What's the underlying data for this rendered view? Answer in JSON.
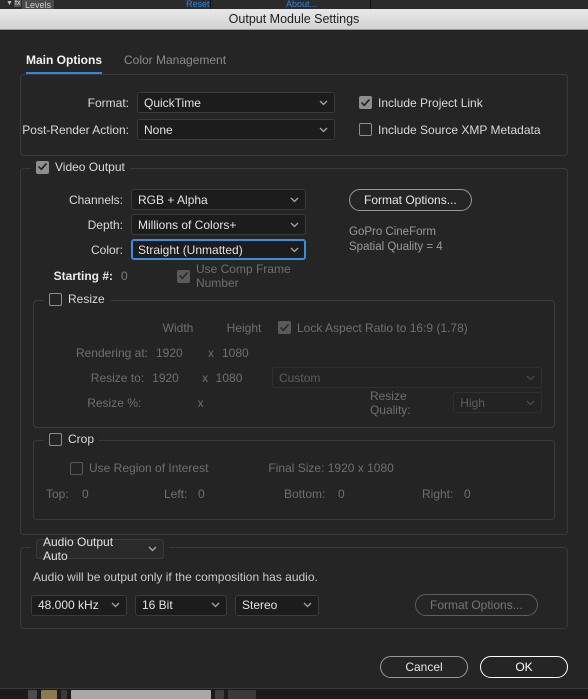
{
  "background_strip": {
    "caret": "▼",
    "fx_badge": "fx",
    "effect_name": "Levels",
    "reset_link": "Reset",
    "about_link": "About..."
  },
  "dialog": {
    "title": "Output Module Settings",
    "tabs": [
      {
        "label": "Main Options",
        "active": true
      },
      {
        "label": "Color Management",
        "active": false
      }
    ],
    "format_group": {
      "format_label": "Format:",
      "format_value": "QuickTime",
      "post_render_label": "Post-Render Action:",
      "post_render_value": "None",
      "include_project_link": {
        "label": "Include Project Link",
        "checked": true
      },
      "include_xmp": {
        "label": "Include Source XMP Metadata",
        "checked": false
      }
    },
    "video_output": {
      "legend": "Video Output",
      "checked": true,
      "channels_label": "Channels:",
      "channels_value": "RGB + Alpha",
      "depth_label": "Depth:",
      "depth_value": "Millions of Colors+",
      "color_label": "Color:",
      "color_value": "Straight (Unmatted)",
      "color_focused": true,
      "starting_label": "Starting #:",
      "starting_value": "0",
      "use_comp_frame": {
        "label": "Use Comp Frame Number",
        "checked": true
      },
      "format_options_label": "Format Options...",
      "codec_line1": "GoPro CineForm",
      "codec_line2": "Spatial Quality = 4"
    },
    "resize": {
      "legend": "Resize",
      "checked": false,
      "width_header": "Width",
      "height_header": "Height",
      "lock_aspect": {
        "label": "Lock Aspect Ratio to 16:9 (1.78)",
        "checked": true
      },
      "rendering_at_label": "Rendering at:",
      "rendering_width": "1920",
      "rendering_x": "x",
      "rendering_height": "1080",
      "resize_to_label": "Resize to:",
      "resize_width": "1920",
      "resize_x": "x",
      "resize_height": "1080",
      "preset_value": "Custom",
      "resize_pct_label": "Resize %:",
      "resize_pct_x": "x",
      "resize_quality_label": "Resize Quality:",
      "resize_quality_value": "High"
    },
    "crop": {
      "legend": "Crop",
      "checked": false,
      "use_roi": {
        "label": "Use Region of Interest",
        "checked": false
      },
      "final_size": "Final Size: 1920 x 1080",
      "top_label": "Top:",
      "top_value": "0",
      "left_label": "Left:",
      "left_value": "0",
      "bottom_label": "Bottom:",
      "bottom_value": "0",
      "right_label": "Right:",
      "right_value": "0"
    },
    "audio": {
      "mode_value": "Audio Output Auto",
      "note": "Audio will be output only if the composition has audio.",
      "sample_rate": "48.000 kHz",
      "bit_depth": "16 Bit",
      "channels": "Stereo",
      "format_options_label": "Format Options..."
    },
    "footer": {
      "cancel_label": "Cancel",
      "ok_label": "OK"
    }
  },
  "colors": {
    "accent": "#2f87e0",
    "focus": "#3d8ee0",
    "dialog_bg": "#252525",
    "titlebar": "#e0e0e0"
  }
}
